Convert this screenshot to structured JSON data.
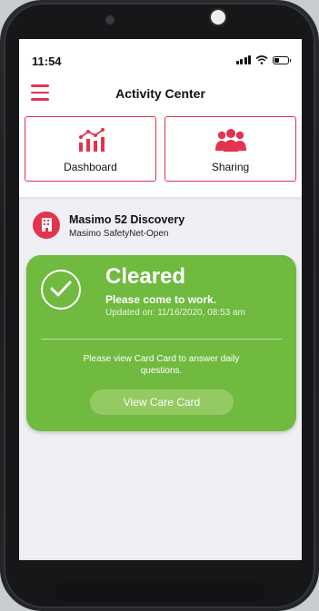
{
  "status_bar": {
    "time": "11:54"
  },
  "nav": {
    "title": "Activity Center",
    "menu_icon": "hamburger-menu-icon"
  },
  "tiles": [
    {
      "label": "Dashboard",
      "icon": "chart-icon"
    },
    {
      "label": "Sharing",
      "icon": "people-group-icon"
    }
  ],
  "location": {
    "name": "Masimo 52 Discovery",
    "subtitle": "Masimo SafetyNet-Open",
    "icon": "building-icon"
  },
  "status_card": {
    "status": "Cleared",
    "message": "Please come to work.",
    "updated": "Updated on: 11/16/2020, 08:53 am",
    "instruction": "Please view Card Card to answer daily questions.",
    "button_label": "View Care Card",
    "color": "#6fba3f"
  },
  "colors": {
    "accent": "#e3334d",
    "cleared": "#6fba3f"
  }
}
